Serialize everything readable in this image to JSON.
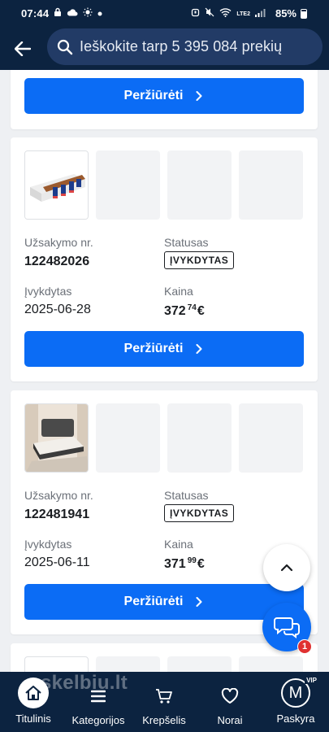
{
  "status_bar": {
    "time": "07:44",
    "network": "LTE2",
    "battery": "85%"
  },
  "header": {
    "search_placeholder": "Ieškokite tarp 5 395 084 prekių"
  },
  "orders": {
    "view_label": "Peržiūrėti",
    "order_no_label": "Užsakymo nr.",
    "status_label": "Statusas",
    "done_label": "Įvykdytas",
    "price_label": "Kaina",
    "items": [
      {
        "order_no": "122482026",
        "status": "ĮVYKDYTAS",
        "date": "2025-06-28",
        "price_int": "372",
        "price_cents": "74",
        "currency": "€",
        "image": "mattress"
      },
      {
        "order_no": "122481941",
        "status": "ĮVYKDYTAS",
        "date": "2025-06-11",
        "price_int": "371",
        "price_cents": "99",
        "currency": "€",
        "image": "bed"
      }
    ]
  },
  "chat": {
    "badge_count": "1"
  },
  "bottom_nav": {
    "watermark": "skelbiu.lt",
    "items": [
      {
        "label": "Titulinis",
        "icon": "home-icon",
        "active": true
      },
      {
        "label": "Kategorijos",
        "icon": "menu-icon"
      },
      {
        "label": "Krepšelis",
        "icon": "cart-icon"
      },
      {
        "label": "Norai",
        "icon": "heart-icon"
      },
      {
        "label": "Paskyra",
        "icon": "avatar",
        "initial": "M",
        "tag": "VIP"
      }
    ]
  },
  "colors": {
    "header_bg": "#0c2340",
    "accent": "#0b6cf5",
    "badge_red": "#e03131"
  }
}
